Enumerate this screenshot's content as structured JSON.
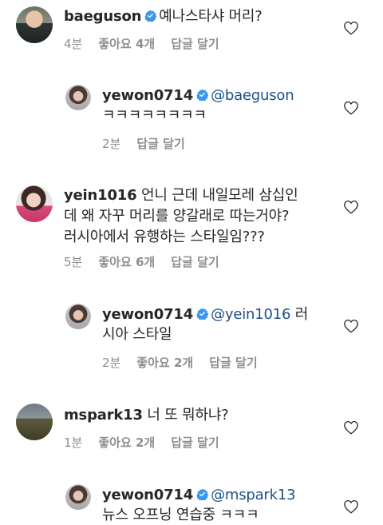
{
  "comments": [
    {
      "username": "baeguson",
      "text": "예나스타샤 머리?",
      "time": "4분",
      "likes": "좋아요 4개",
      "reply": "답글 달기",
      "replies": [
        {
          "username": "yewon0714",
          "mention": "@baeguson",
          "text": "ㅋㅋㅋㅋㅋㅋㅋㅋ",
          "time": "2분",
          "reply": "답글 달기"
        }
      ]
    },
    {
      "username": "yein1016",
      "text_line1": "언니 근데 내일모레 삼십인",
      "text_line2": "데 왜 자꾸 머리를 양갈래로 따는거야?",
      "text_line3": "러시아에서 유행하는 스타일임???",
      "time": "5분",
      "likes": "좋아요 6개",
      "reply": "답글 달기",
      "replies": [
        {
          "username": "yewon0714",
          "mention": "@yein1016",
          "text_after": " 러",
          "text_line2": "시아 스타일",
          "time": "2분",
          "likes": "좋아요 2개",
          "reply": "답글 달기"
        }
      ]
    },
    {
      "username": "mspark13",
      "text": "너 또 뭐하냐?",
      "time": "1분",
      "likes": "좋아요 2개",
      "reply": "답글 달기",
      "replies": [
        {
          "username": "yewon0714",
          "mention": "@mspark13",
          "text_line2": "뉴스 오프닝 연습중 ㅋㅋㅋ"
        }
      ]
    }
  ],
  "icons": {
    "verified": "verified-badge-icon",
    "like": "heart-icon"
  },
  "colors": {
    "verified": "#3897f0",
    "mention": "#1f4f88",
    "meta": "#8e8e8e"
  }
}
